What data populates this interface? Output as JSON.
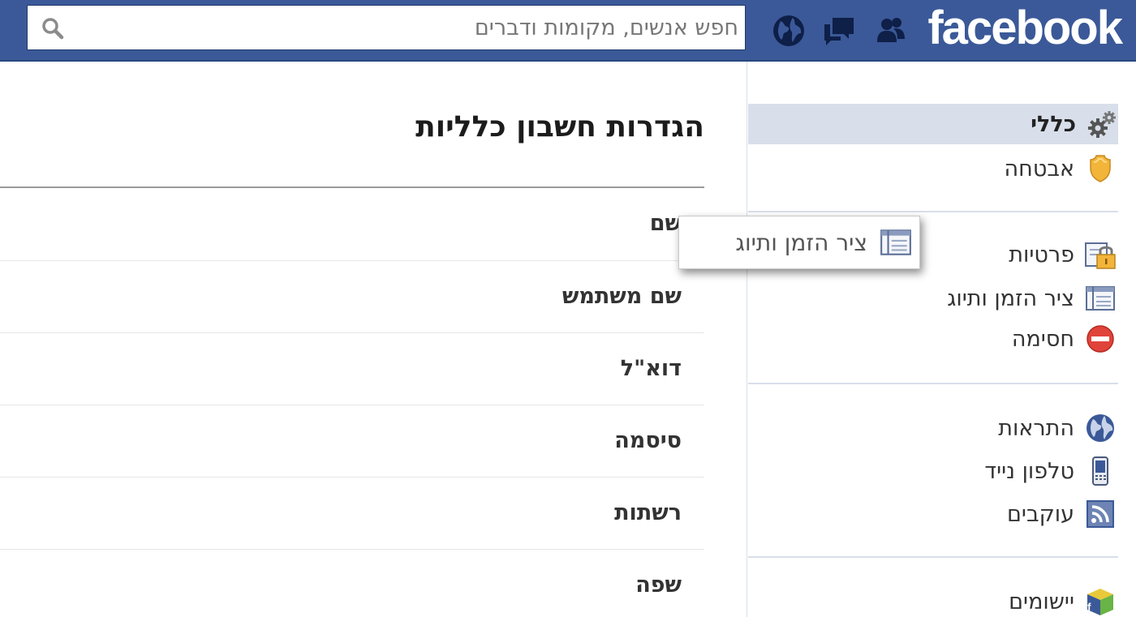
{
  "header": {
    "logo_text": "facebook",
    "search_placeholder": "חפש אנשים, מקומות ודברים",
    "brand_color": "#3b5998",
    "icons": [
      "friend-requests-icon",
      "messages-icon",
      "notifications-globe-icon",
      "search-icon"
    ]
  },
  "sidebar": {
    "items": [
      {
        "label": "כללי",
        "icon": "gears-icon",
        "selected": true
      },
      {
        "label": "אבטחה",
        "icon": "security-badge-icon"
      },
      {
        "label": "פרטיות",
        "icon": "privacy-lock-icon"
      },
      {
        "label": "ציר הזמן ותיוג",
        "icon": "timeline-icon"
      },
      {
        "label": "חסימה",
        "icon": "blocking-icon"
      },
      {
        "label": "התראות",
        "icon": "globe-icon"
      },
      {
        "label": "טלפון נייד",
        "icon": "mobile-phone-icon"
      },
      {
        "label": "עוקבים",
        "icon": "rss-icon"
      },
      {
        "label": "יישומים",
        "icon": "apps-cube-icon"
      }
    ],
    "selected_bg": "#d8dfea"
  },
  "main": {
    "title": "הגדרות חשבון כלליות",
    "rows": [
      {
        "label": "שם"
      },
      {
        "label": "שם משתמש"
      },
      {
        "label": "דוא\"ל"
      },
      {
        "label": "סיסמה"
      },
      {
        "label": "רשתות"
      },
      {
        "label": "שפה"
      }
    ]
  },
  "tooltip": {
    "label": "ציר הזמן ותיוג",
    "icon": "timeline-icon"
  }
}
